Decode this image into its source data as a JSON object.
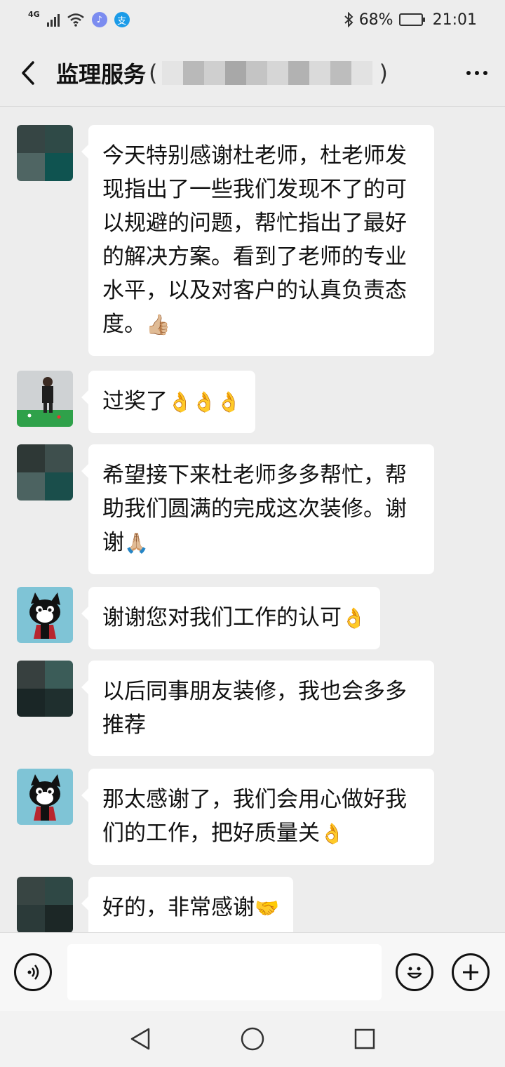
{
  "status_bar": {
    "network": "4G",
    "battery": "68%",
    "time": "21:01",
    "battery_level": 0.68
  },
  "header": {
    "title": "监理服务",
    "paren_open": "(",
    "paren_close": ")"
  },
  "messages": [
    {
      "avatar": "client-avatar-blurred",
      "text": "今天特别感谢杜老师，杜老师发现指出了一些我们发现不了的可以规避的问题，帮忙指出了最好的解决方案。看到了老师的专业水平，以及对客户的认真负责态度。",
      "emoji": "👍🏼"
    },
    {
      "avatar": "billiards-player-avatar",
      "text": "过奖了",
      "emoji": "👌👌👌"
    },
    {
      "avatar": "client-avatar-blurred",
      "text": "希望接下来杜老师多多帮忙，帮助我们圆满的完成这次装修。谢谢",
      "emoji": "🙏🏼"
    },
    {
      "avatar": "cat-avatar",
      "text": "谢谢您对我们工作的认可",
      "emoji": "👌"
    },
    {
      "avatar": "client-avatar-blurred",
      "text": "以后同事朋友装修，我也会多多推荐",
      "emoji": ""
    },
    {
      "avatar": "cat-avatar",
      "text": "那太感谢了，我们会用心做好我们的工作，把好质量关",
      "emoji": "👌"
    },
    {
      "avatar": "client-avatar-blurred",
      "text": "好的，非常感谢",
      "emoji": "🤝"
    }
  ],
  "input_bar": {
    "voice_icon": "voice-icon",
    "emoji_icon": "smiley-icon",
    "plus_icon": "plus-icon",
    "value": ""
  },
  "nav_bar": {
    "back_icon": "triangle-back-icon",
    "home_icon": "circle-home-icon",
    "recents_icon": "square-recents-icon"
  }
}
